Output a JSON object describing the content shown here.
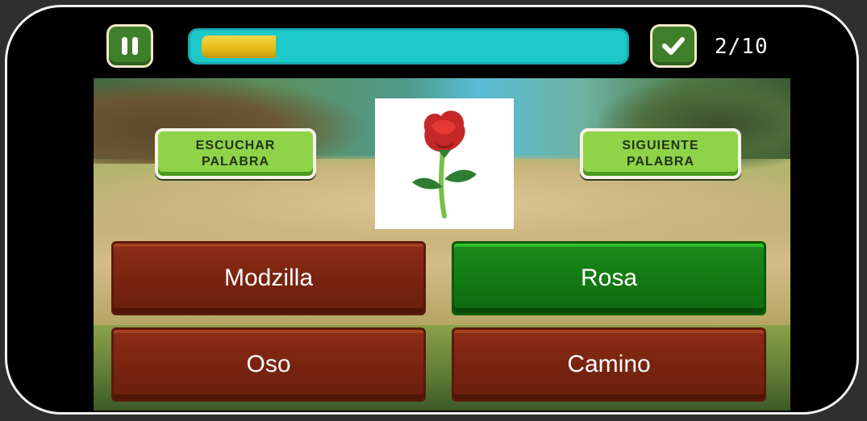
{
  "top_bar": {
    "pause_icon": "pause-icon",
    "check_icon": "check-icon",
    "progress": 0.18,
    "counter": "2/10"
  },
  "buttons": {
    "listen_label": "ESCUCHAR PALABRA",
    "next_label": "SIGUIENTE PALABRA"
  },
  "image": {
    "icon": "rose-icon"
  },
  "answers": [
    {
      "label": "Modzilla",
      "state": "default"
    },
    {
      "label": "Rosa",
      "state": "correct"
    },
    {
      "label": "Oso",
      "state": "default"
    },
    {
      "label": "Camino",
      "state": "default"
    }
  ],
  "colors": {
    "progress_track": "#1ec9c9",
    "progress_fill": "#e6b813",
    "button_green": "#8fd348",
    "wood": "#7a2410",
    "correct": "#157a14"
  }
}
